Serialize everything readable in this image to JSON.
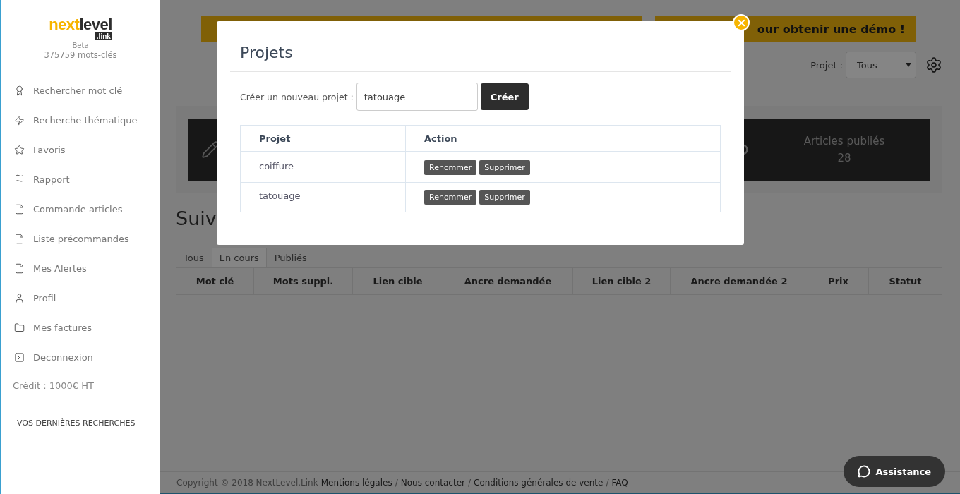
{
  "sidebar": {
    "logo": {
      "first": "next",
      "second": "level",
      "suffix": ".link"
    },
    "beta": "Beta",
    "keyword_count": "375759 mots-clés",
    "menu": [
      {
        "label": "Rechercher mot clé",
        "kind": "award"
      },
      {
        "label": "Recherche thématique",
        "kind": "bolt"
      },
      {
        "label": "Favoris",
        "kind": "star"
      },
      {
        "label": "Rapport",
        "kind": "flag"
      },
      {
        "label": "Commande articles",
        "kind": "file"
      },
      {
        "label": "Liste précommandes",
        "kind": "file"
      },
      {
        "label": "Mes Alertes",
        "kind": "file"
      },
      {
        "label": "Profil",
        "kind": "user"
      },
      {
        "label": "Mes factures",
        "kind": "folder"
      },
      {
        "label": "Deconnexion",
        "kind": "logout"
      }
    ],
    "credit": "Crédit : 1000€ HT",
    "recent_heading": "VOS DERNIÈRES RECHERCHES"
  },
  "main": {
    "demo_banner": "our obtenir une démo !",
    "project_filter": {
      "label": "Projet :",
      "value": "Tous"
    },
    "stat": {
      "label": "Articles publiés",
      "value": "28"
    },
    "heading": "Suiv",
    "tabs": [
      {
        "label": "Tous",
        "selected": false
      },
      {
        "label": "En cours",
        "selected": true
      },
      {
        "label": "Publiés",
        "selected": false
      }
    ],
    "table": {
      "columns": [
        "Mot clé",
        "Mots suppl.",
        "Lien cible",
        "Ancre demandée",
        "Lien cible 2",
        "Ancre demandée 2",
        "Prix",
        "Statut"
      ]
    }
  },
  "footer": {
    "copyright": "Copyright © 2018 NextLevel.Link",
    "links": [
      "Mentions légales",
      "Nous contacter",
      "Conditions générales de vente",
      "FAQ"
    ],
    "separator": "/"
  },
  "assistance": "Assistance",
  "modal": {
    "title": "Projets",
    "create_label": "Créer un nouveau projet :",
    "input_value": "tatouage",
    "create_button": "Créer",
    "table": {
      "columns": [
        "Projet",
        "Action"
      ],
      "rows": [
        {
          "name": "coiffure",
          "actions": [
            "Renommer",
            "Supprimer"
          ]
        },
        {
          "name": "tatouage",
          "actions": [
            "Renommer",
            "Supprimer"
          ]
        }
      ]
    }
  }
}
